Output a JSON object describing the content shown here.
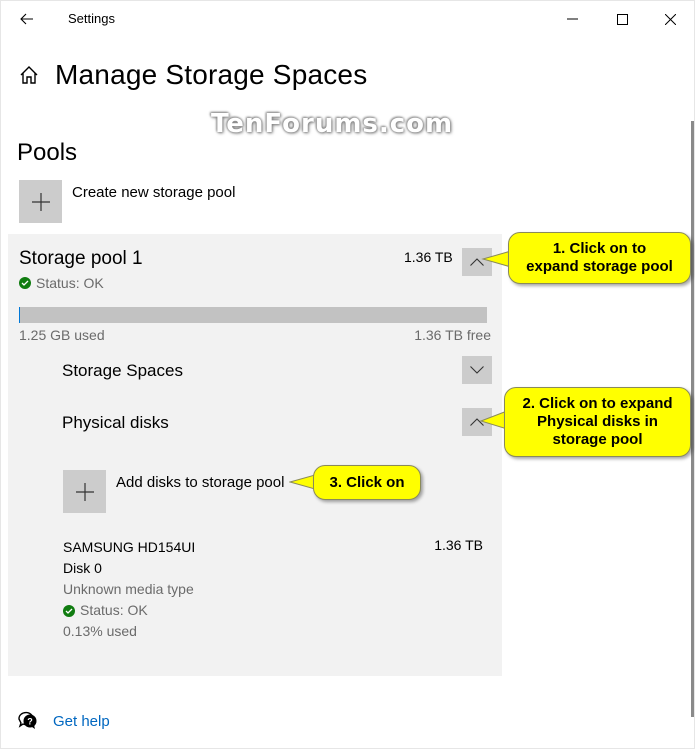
{
  "window": {
    "title": "Settings",
    "controls": {
      "minimize": "minimize",
      "maximize": "maximize",
      "close": "close"
    }
  },
  "header": {
    "title": "Manage Storage Spaces",
    "icon": "home-icon"
  },
  "watermark": "TenForums.com",
  "pools": {
    "section_title": "Pools",
    "create_label": "Create new storage pool",
    "pool": {
      "name": "Storage pool 1",
      "size": "1.36 TB",
      "status": "Status: OK",
      "used_fraction": 0.0009,
      "used_label": "1.25 GB used",
      "free_label": "1.36 TB free",
      "storage_spaces_label": "Storage Spaces",
      "physical_disks_label": "Physical disks",
      "add_disks_label": "Add disks to storage pool",
      "disks": [
        {
          "name": "SAMSUNG HD154UI",
          "number": "Disk 0",
          "media": "Unknown media type",
          "status": "Status: OK",
          "used": "0.13% used",
          "size": "1.36 TB"
        }
      ]
    }
  },
  "footer": {
    "help_label": "Get help"
  },
  "callouts": {
    "one": "1. Click on to expand storage pool",
    "one_line1": "1. Click on to",
    "one_line2": "expand storage pool",
    "two_line1": "2. Click on to expand",
    "two_line2": "Physical disks in",
    "two_line3": "storage pool",
    "three": "3. Click on"
  },
  "colors": {
    "accent": "#0078d7",
    "link": "#0067c0",
    "status_ok": "#107c10",
    "callout": "#ffff00",
    "card_bg": "#f2f2f2",
    "tile_bg": "#cccccc"
  }
}
